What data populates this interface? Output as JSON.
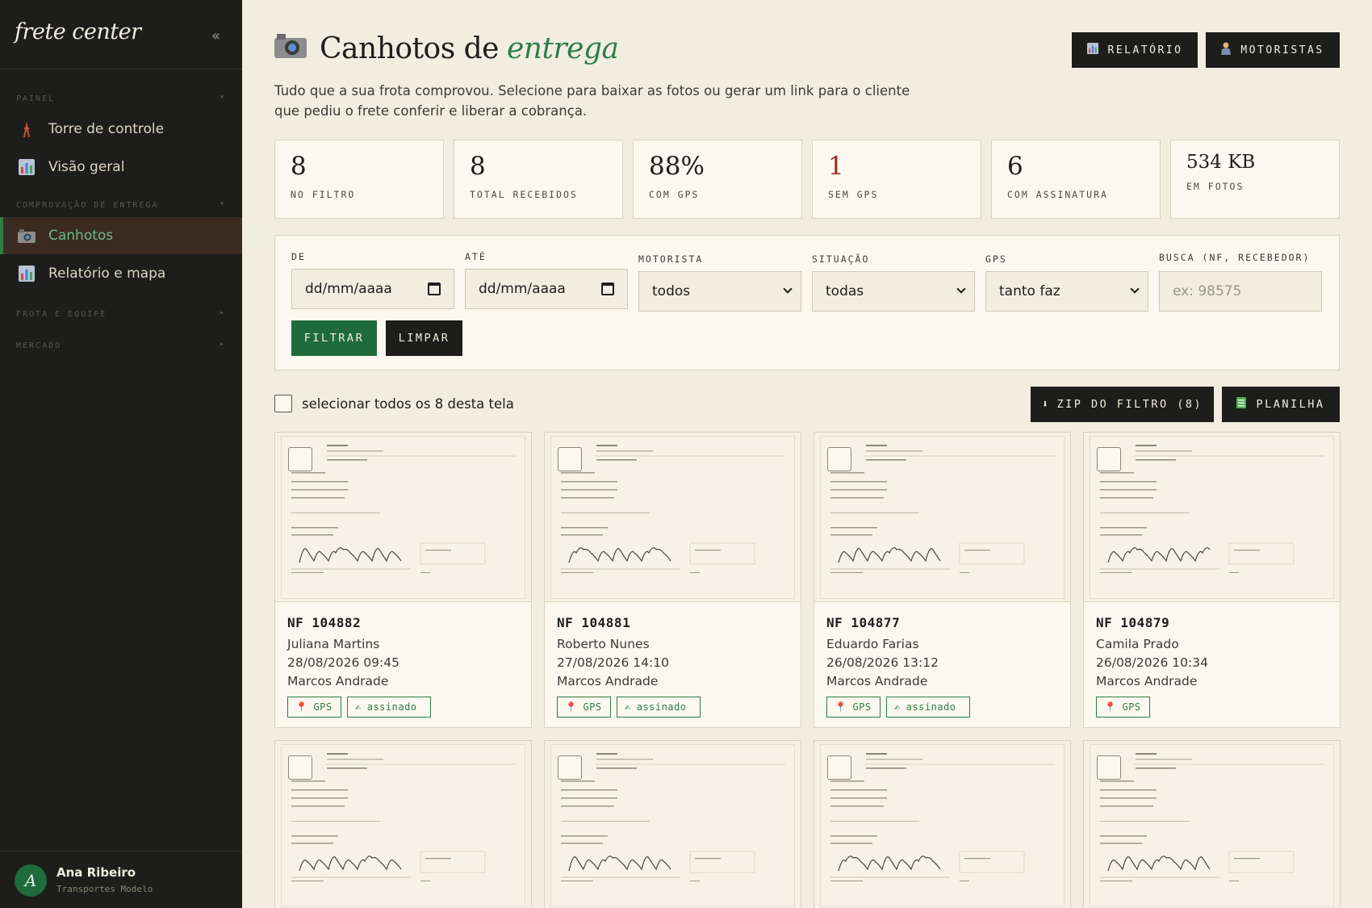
{
  "sidebar": {
    "brand": "frete center",
    "collapse": "«",
    "sections": [
      {
        "label": "PAINEL"
      },
      {
        "label": "COMPROVAÇÃO DE ENTREGA"
      },
      {
        "label": "FROTA E EQUIPE"
      },
      {
        "label": "MERCADO"
      }
    ],
    "items": [
      {
        "label": "Torre de controle",
        "icon": "tower-icon"
      },
      {
        "label": "Visão geral",
        "icon": "chart-icon"
      },
      {
        "label": "Canhotos",
        "icon": "camera-icon",
        "active": true
      },
      {
        "label": "Relatório e mapa",
        "icon": "chart-icon"
      }
    ],
    "user": {
      "initial": "A",
      "name": "Ana Ribeiro",
      "company": "Transportes Modelo"
    }
  },
  "header": {
    "title_main": "Canhotos de",
    "title_accent": "entrega",
    "description": "Tudo que a sua frota comprovou. Selecione para baixar as fotos ou gerar um link para o cliente que pediu o frete conferir e liberar a cobrança.",
    "buttons": {
      "report": "RELATÓRIO",
      "drivers": "MOTORISTAS"
    }
  },
  "stats": [
    {
      "value": "8",
      "label": "NO FILTRO"
    },
    {
      "value": "8",
      "label": "TOTAL RECEBIDOS"
    },
    {
      "value": "88%",
      "label": "COM GPS"
    },
    {
      "value": "1",
      "label": "SEM GPS"
    },
    {
      "value": "6",
      "label": "COM ASSINATURA"
    },
    {
      "value": "534 KB",
      "label": "EM FOTOS"
    }
  ],
  "filters": {
    "from_label": "DE",
    "from_value": "dd/mm/aaaa",
    "to_label": "ATÉ",
    "to_value": "dd/mm/aaaa",
    "driver_label": "MOTORISTA",
    "driver_value": "todos",
    "status_label": "SITUAÇÃO",
    "status_value": "todas",
    "gps_label": "GPS",
    "gps_value": "tanto faz",
    "search_label": "BUSCA (NF, RECEBEDOR)",
    "search_placeholder": "ex: 98575",
    "apply": "FILTRAR",
    "clear": "LIMPAR"
  },
  "toolbar": {
    "select_all": "selecionar todos os 8 desta tela",
    "zip": "ZIP DO FILTRO (8)",
    "sheet": "PLANILHA"
  },
  "cards": [
    {
      "nf": "NF 104882",
      "receiver": "Juliana Martins",
      "datetime": "28/08/2026 09:45",
      "driver": "Marcos Andrade",
      "badges": [
        "GPS",
        "assinado"
      ]
    },
    {
      "nf": "NF 104881",
      "receiver": "Roberto Nunes",
      "datetime": "27/08/2026 14:10",
      "driver": "Marcos Andrade",
      "badges": [
        "GPS",
        "assinado"
      ]
    },
    {
      "nf": "NF 104877",
      "receiver": "Eduardo Farias",
      "datetime": "26/08/2026 13:12",
      "driver": "Marcos Andrade",
      "badges": [
        "GPS",
        "assinado"
      ]
    },
    {
      "nf": "NF 104879",
      "receiver": "Camila Prado",
      "datetime": "26/08/2026 10:34",
      "driver": "Marcos Andrade",
      "badges": [
        "GPS"
      ]
    },
    {},
    {},
    {},
    {}
  ],
  "colors": {
    "accent": "#2f7d46",
    "sidebar": "#1d1d1b",
    "background": "#f1ede1",
    "alert": "#9a2a20"
  }
}
